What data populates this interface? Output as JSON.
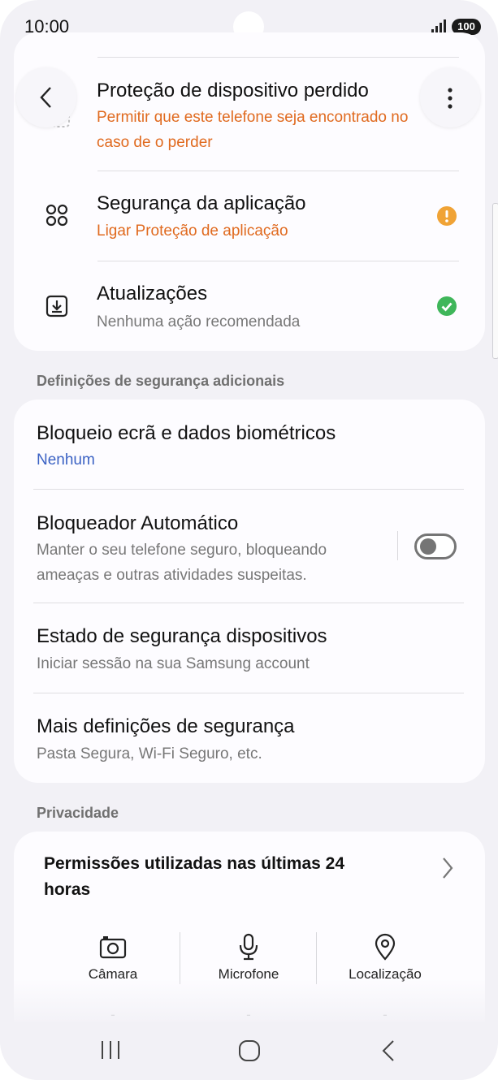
{
  "status_bar": {
    "time": "10:00",
    "battery": "100"
  },
  "security_items": [
    {
      "title": "Proteção de dispositivo perdido",
      "subtitle": "Permitir que este telefone seja encontrado no caso de o perder",
      "status": "warning",
      "icon": "lost-device-icon"
    },
    {
      "title": "Segurança da aplicação",
      "subtitle": "Ligar Proteção de aplicação",
      "status": "warning",
      "icon": "app-grid-icon"
    },
    {
      "title": "Atualizações",
      "subtitle": "Nenhuma ação recomendada",
      "status": "ok",
      "icon": "download-box-icon"
    }
  ],
  "additional": {
    "header": "Definições de segurança adicionais",
    "items": [
      {
        "title": "Bloqueio ecrã e dados biométricos",
        "subtitle": "Nenhum"
      },
      {
        "title": "Bloqueador Automático",
        "subtitle": "Manter o seu telefone seguro, bloqueando ameaças e outras atividades suspeitas.",
        "toggle": "off"
      },
      {
        "title": "Estado de segurança dispositivos",
        "subtitle": "Iniciar sessão na sua Samsung account"
      },
      {
        "title": "Mais definições de segurança",
        "subtitle": "Pasta Segura, Wi-Fi Seguro, etc."
      }
    ]
  },
  "privacy": {
    "header": "Privacidade",
    "permissions_title": "Permissões utilizadas nas últimas 24 horas",
    "permissions": [
      {
        "label": "Câmara",
        "icon": "camera-icon",
        "value": "-"
      },
      {
        "label": "Microfone",
        "icon": "microphone-icon",
        "value": "-"
      },
      {
        "label": "Localização",
        "icon": "location-icon",
        "value": "-"
      }
    ]
  },
  "colors": {
    "warning": "#f0a336",
    "ok": "#3fb65a",
    "accent_orange": "#e06a1f",
    "accent_blue": "#3b62c4"
  }
}
